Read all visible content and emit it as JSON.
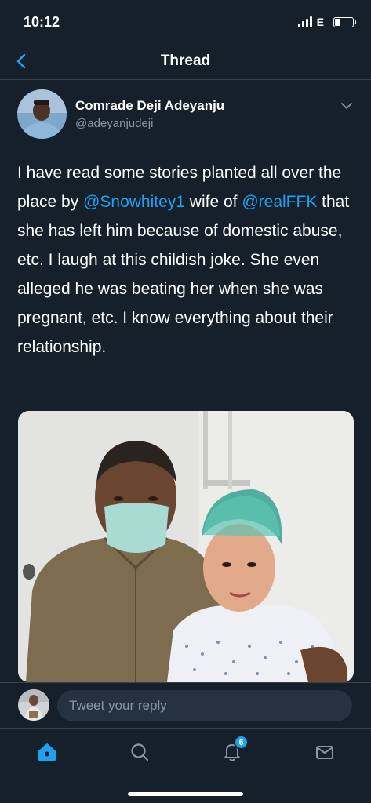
{
  "status_bar": {
    "time": "10:12",
    "network": "E",
    "battery_level": 0.35
  },
  "nav": {
    "title": "Thread",
    "back_icon": "chevron-left-icon"
  },
  "tweet": {
    "author_name": "Comrade Deji Adeyanju",
    "author_handle": "@adeyanjudeji",
    "text_parts": {
      "p1": "I have read some stories planted all over the place by ",
      "m1": "@Snowhitey1",
      "p2": " wife of ",
      "m2": "@realFFK",
      "p3": " that she has left him because of domestic abuse, etc. I laugh at this childish joke. She even alleged he was beating her when she was pregnant, etc. I know everything about their relationship."
    },
    "more_icon": "chevron-down-icon"
  },
  "reply": {
    "placeholder": "Tweet your reply"
  },
  "tabs": {
    "home_icon": "home-icon",
    "search_icon": "search-icon",
    "notifications_icon": "bell-icon",
    "notifications_badge": "6",
    "messages_icon": "mail-icon"
  },
  "colors": {
    "background": "#15202b",
    "accent": "#1da1f2",
    "secondary_text": "#8899a6",
    "divider": "#38444d",
    "input_bg": "#253341"
  }
}
